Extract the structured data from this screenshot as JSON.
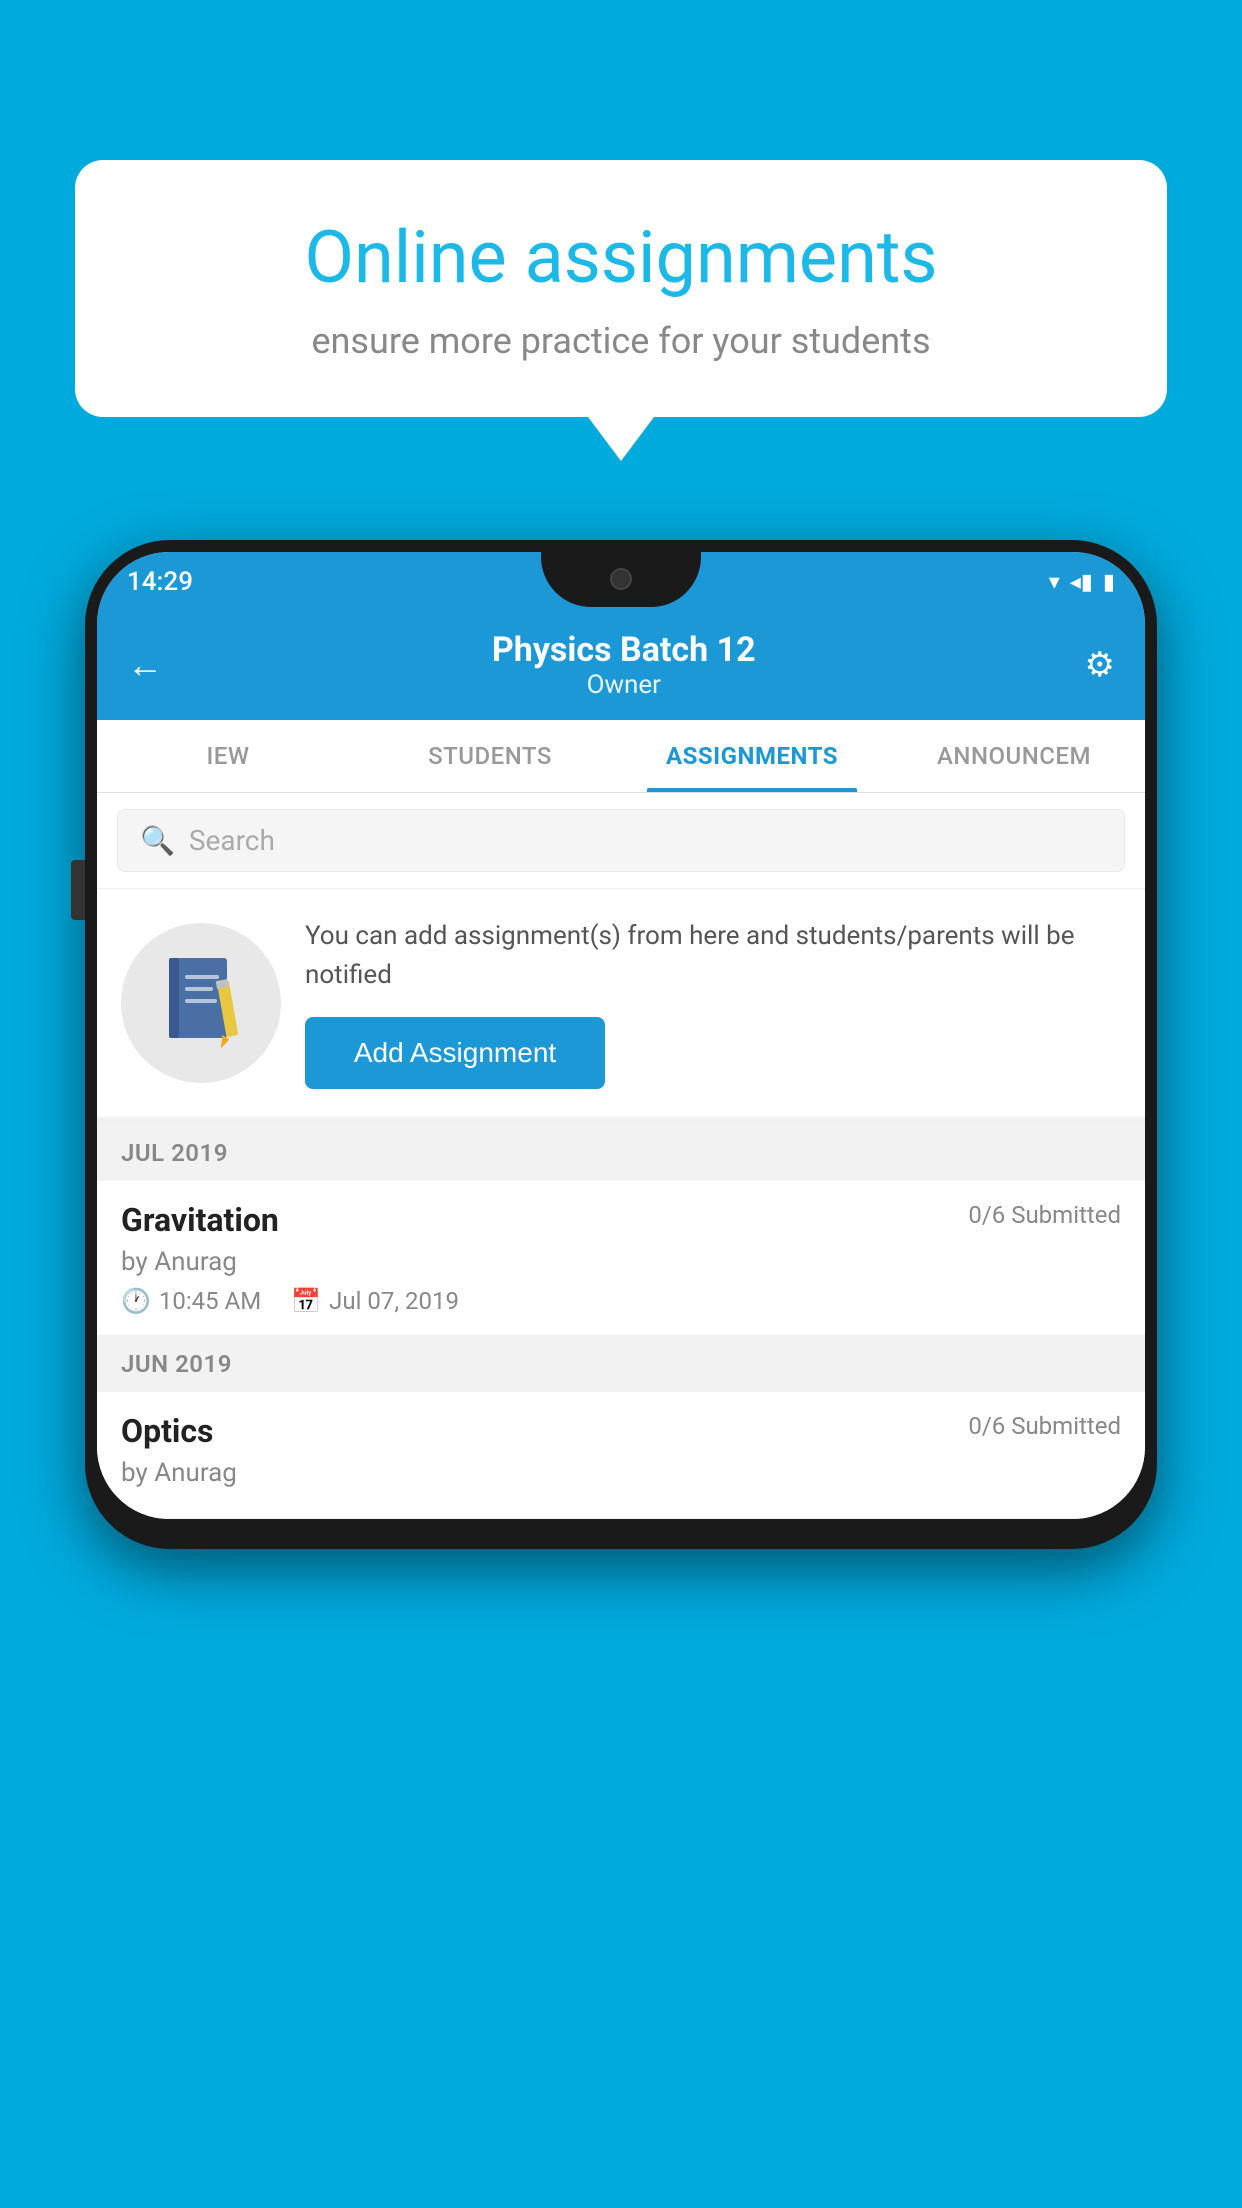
{
  "background_color": "#00AADD",
  "speech_bubble": {
    "title": "Online assignments",
    "subtitle": "ensure more practice for your students"
  },
  "status_bar": {
    "time": "14:29",
    "icons": "▾◂▮"
  },
  "app_header": {
    "title": "Physics Batch 12",
    "subtitle": "Owner",
    "back_label": "←",
    "gear_label": "⚙"
  },
  "tabs": [
    {
      "label": "IEW",
      "active": false
    },
    {
      "label": "STUDENTS",
      "active": false
    },
    {
      "label": "ASSIGNMENTS",
      "active": true
    },
    {
      "label": "ANNOUNCEM",
      "active": false
    }
  ],
  "search": {
    "placeholder": "Search"
  },
  "info_card": {
    "description": "You can add assignment(s) from here and students/parents will be notified",
    "button_label": "Add Assignment"
  },
  "month_sections": [
    {
      "month": "JUL 2019",
      "assignments": [
        {
          "title": "Gravitation",
          "submitted": "0/6 Submitted",
          "author": "by Anurag",
          "time": "10:45 AM",
          "date": "Jul 07, 2019"
        }
      ]
    },
    {
      "month": "JUN 2019",
      "assignments": [
        {
          "title": "Optics",
          "submitted": "0/6 Submitted",
          "author": "by Anurag",
          "time": "",
          "date": ""
        }
      ]
    }
  ],
  "icons": {
    "back": "←",
    "gear": "⚙",
    "search": "🔍",
    "clock": "🕐",
    "calendar": "📅"
  }
}
